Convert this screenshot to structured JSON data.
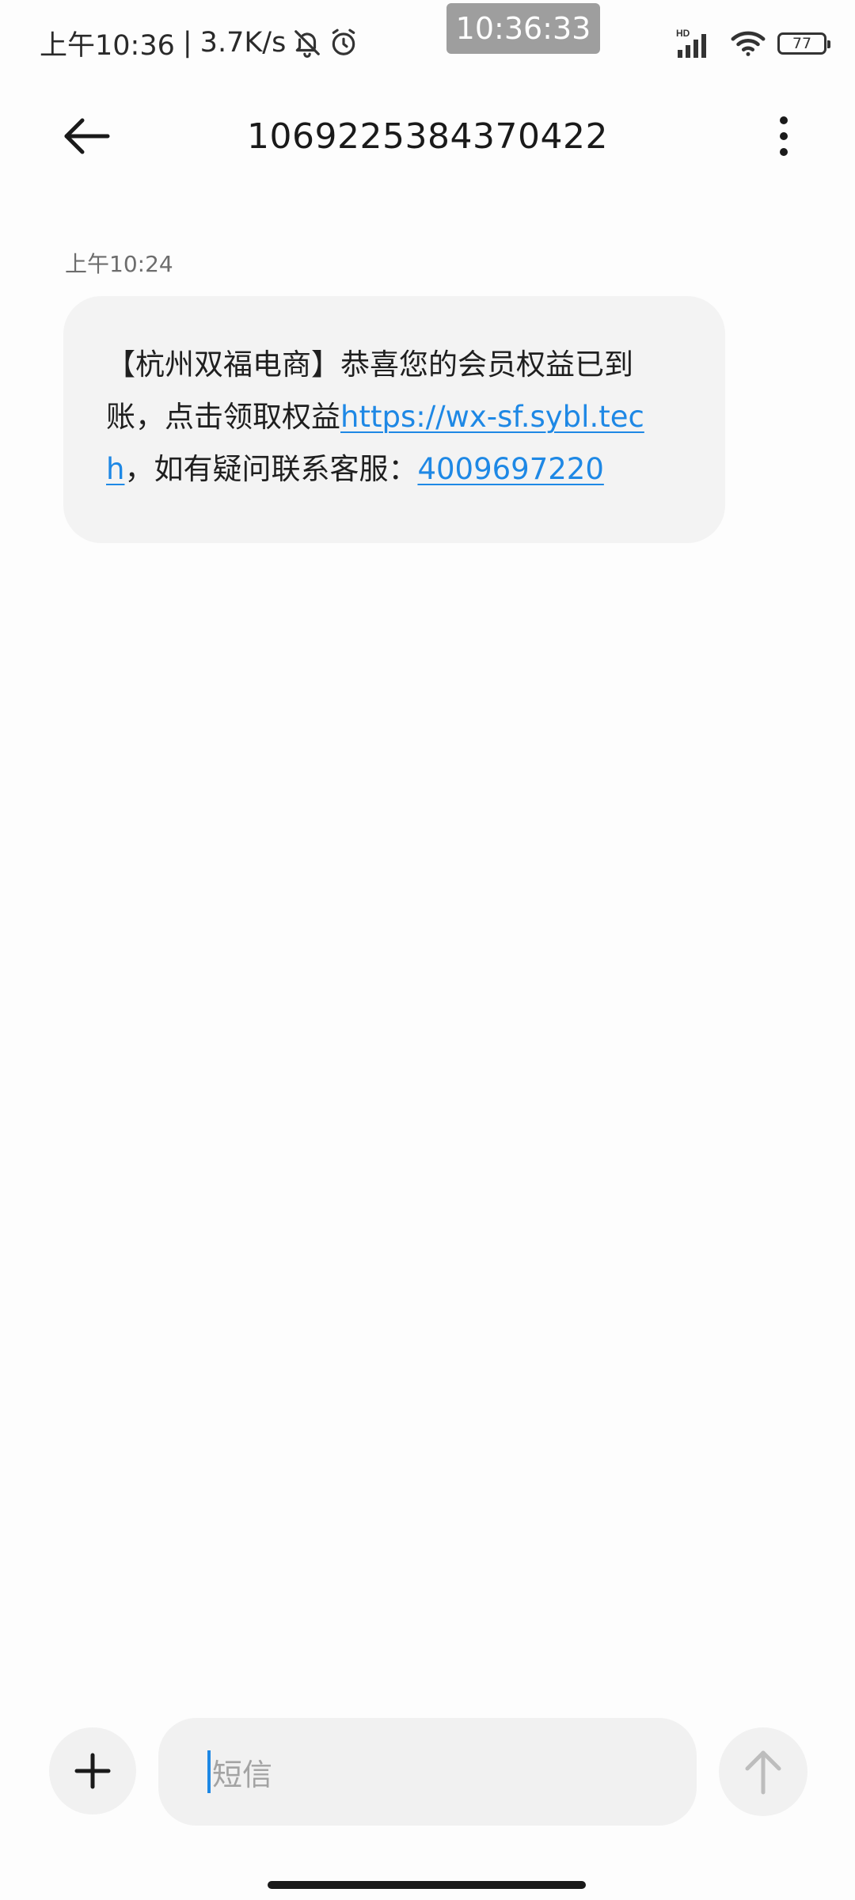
{
  "status_bar": {
    "time": "上午10:36",
    "separator": "|",
    "network_speed": "3.7K/s",
    "clock_overlay": "10:36:33",
    "network_badge": "HD",
    "battery_level": "77",
    "icons": [
      "bell-off-icon",
      "alarm-icon",
      "signal-icon",
      "wifi-icon",
      "battery-icon"
    ]
  },
  "header": {
    "title": "1069225384370422",
    "back_icon": "arrow-left-icon",
    "more_icon": "more-vertical-icon"
  },
  "conversation": {
    "messages": [
      {
        "timestamp": "上午10:24",
        "text_part1": "【杭州双福电商】恭喜您的会员权益已到账，点击领取权益",
        "link": "https://wx-sf.sybl.tech",
        "text_part2": "，如有疑问联系客服：",
        "phone": "4009697220"
      }
    ]
  },
  "composer": {
    "placeholder": "短信",
    "attach_icon": "plus-icon",
    "send_icon": "arrow-up-icon"
  },
  "colors": {
    "link": "#1e88e5",
    "bubble_bg": "#f3f3f3",
    "input_bg": "#f1f1f1",
    "clock_overlay_bg": "#9e9e9e"
  }
}
